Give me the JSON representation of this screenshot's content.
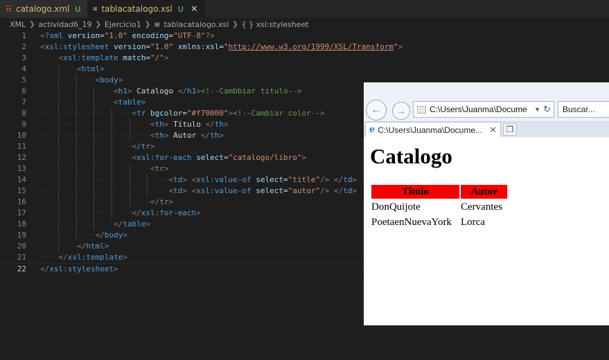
{
  "editor_tabs": [
    {
      "label": "catalogo.xml",
      "status": "U",
      "icon": "rss-file-icon"
    },
    {
      "label": "tablacatalogo.xsl",
      "status": "U",
      "icon": "xsl-file-icon",
      "close": "✕"
    }
  ],
  "breadcrumb": [
    "XML",
    "actividad6_19",
    "Ejercicio1",
    "tablacatalogo.xsl",
    "{ } xsl:stylesheet"
  ],
  "code_lines": [
    {
      "n": "1",
      "text": "<?xml version=\"1.0\" encoding=\"UTF-8\"?>"
    },
    {
      "n": "2",
      "text": "<xsl:stylesheet version=\"1.0\" xmlns:xsl=\"http://www.w3.org/1999/XSL/Transform\">"
    },
    {
      "n": "3",
      "text": "<xsl:template match=\"/\">"
    },
    {
      "n": "4",
      "text": "<html>"
    },
    {
      "n": "5",
      "text": "<body>"
    },
    {
      "n": "6",
      "text": "<h1> Catalogo </h1><!--Cambbiar titulo-->"
    },
    {
      "n": "7",
      "text": "<table>"
    },
    {
      "n": "8",
      "text": "<tr bgcolor=\"#f70000\"><!--Cambiar color-->"
    },
    {
      "n": "9",
      "text": "<th> Título </th>"
    },
    {
      "n": "10",
      "text": "<th> Autor </th>"
    },
    {
      "n": "11",
      "text": "</tr>"
    },
    {
      "n": "12",
      "text": "<xsl:for-each select=\"catalogo/libro\">"
    },
    {
      "n": "13",
      "text": "<tr>"
    },
    {
      "n": "14",
      "text": "<td> <xsl:value-of select=\"title\"/> </td>"
    },
    {
      "n": "15",
      "text": "<td> <xsl:value-of select=\"autor\"/> </td>"
    },
    {
      "n": "16",
      "text": "</tr>"
    },
    {
      "n": "17",
      "text": "</xsl:for-each>"
    },
    {
      "n": "18",
      "text": "</table>"
    },
    {
      "n": "19",
      "text": "</body>"
    },
    {
      "n": "20",
      "text": "</html>"
    },
    {
      "n": "21",
      "text": "</xsl:template>"
    },
    {
      "n": "22",
      "text": "</xsl:stylesheet>"
    }
  ],
  "browser": {
    "address": "C:\\Users\\Juanma\\Docume",
    "search_placeholder": "Buscar...",
    "tab_label": "C:\\Users\\Juanma\\Docume...",
    "page": {
      "title": "Catalogo",
      "header_color": "#f70000",
      "headers": [
        "Título",
        "Autor"
      ],
      "rows": [
        [
          "DonQuijote",
          "Cervantes"
        ],
        [
          "PoetaenNuevaYork",
          "Lorca"
        ]
      ]
    }
  }
}
